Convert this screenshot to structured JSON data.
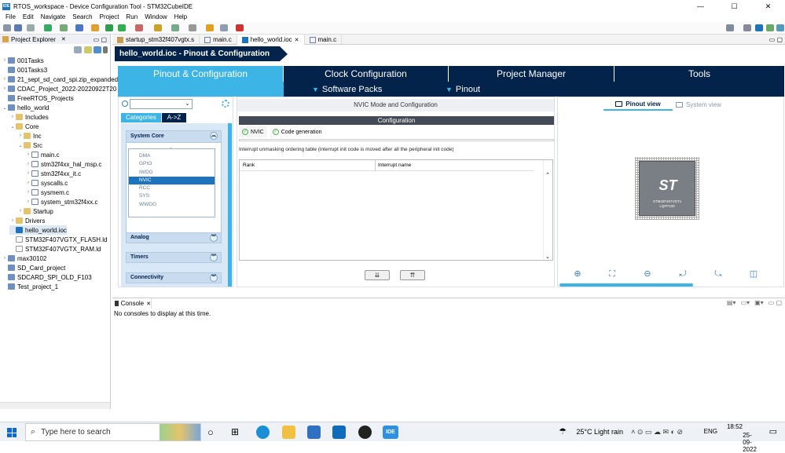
{
  "window": {
    "title": "RTOS_workspace - Device Configuration Tool - STM32CubeIDE",
    "app_icon": "IDE",
    "controls": [
      "—",
      "☐",
      "✕"
    ]
  },
  "menu": [
    "File",
    "Edit",
    "Navigate",
    "Search",
    "Project",
    "Run",
    "Window",
    "Help"
  ],
  "project_explorer": {
    "title": "Project Explorer",
    "items": [
      {
        "label": "001Tasks",
        "depth": 0,
        "arrow": "›",
        "icon": "proj"
      },
      {
        "label": "001Tasks3",
        "depth": 0,
        "arrow": "",
        "icon": "proj"
      },
      {
        "label": "21_sept_sd_card_spi.zip_expanded",
        "depth": 0,
        "arrow": "›",
        "icon": "proj"
      },
      {
        "label": "CDAC_Project_2022-20220922T20",
        "depth": 0,
        "arrow": "›",
        "icon": "proj"
      },
      {
        "label": "FreeRTOS_Projects",
        "depth": 0,
        "arrow": "",
        "icon": "proj"
      },
      {
        "label": "hello_world",
        "depth": 0,
        "arrow": "⌄",
        "icon": "proj"
      },
      {
        "label": "Includes",
        "depth": 1,
        "arrow": "›",
        "icon": "fold"
      },
      {
        "label": "Core",
        "depth": 1,
        "arrow": "⌄",
        "icon": "fold"
      },
      {
        "label": "Inc",
        "depth": 2,
        "arrow": "›",
        "icon": "fold"
      },
      {
        "label": "Src",
        "depth": 2,
        "arrow": "⌄",
        "icon": "fold"
      },
      {
        "label": "main.c",
        "depth": 3,
        "arrow": "›",
        "icon": "file"
      },
      {
        "label": "stm32f4xx_hal_msp.c",
        "depth": 3,
        "arrow": "›",
        "icon": "file"
      },
      {
        "label": "stm32f4xx_it.c",
        "depth": 3,
        "arrow": "›",
        "icon": "file"
      },
      {
        "label": "syscalls.c",
        "depth": 3,
        "arrow": "›",
        "icon": "file"
      },
      {
        "label": "sysmem.c",
        "depth": 3,
        "arrow": "›",
        "icon": "file"
      },
      {
        "label": "system_stm32f4xx.c",
        "depth": 3,
        "arrow": "›",
        "icon": "file"
      },
      {
        "label": "Startup",
        "depth": 2,
        "arrow": "›",
        "icon": "fold"
      },
      {
        "label": "Drivers",
        "depth": 1,
        "arrow": "›",
        "icon": "fold"
      },
      {
        "label": "hello_world.ioc",
        "depth": 1,
        "arrow": "",
        "icon": "ioc"
      },
      {
        "label": "STM32F407VGTX_FLASH.ld",
        "depth": 1,
        "arrow": "",
        "icon": "ld"
      },
      {
        "label": "STM32F407VGTX_RAM.ld",
        "depth": 1,
        "arrow": "",
        "icon": "ld"
      },
      {
        "label": "max30102",
        "depth": 0,
        "arrow": "›",
        "icon": "proj"
      },
      {
        "label": "SD_Card_project",
        "depth": 0,
        "arrow": "",
        "icon": "proj"
      },
      {
        "label": "SDCARD_SPI_OLD_F103",
        "depth": 0,
        "arrow": "",
        "icon": "proj"
      },
      {
        "label": "Test_project_1",
        "depth": 0,
        "arrow": "",
        "icon": "proj"
      }
    ]
  },
  "editor_tabs": [
    "startup_stm32f407vgtx.s",
    "main.c",
    "hello_world.ioc",
    "main.c"
  ],
  "editor_tabs_active": 2,
  "ioc": {
    "banner": "hello_world.ioc - Pinout & Configuration",
    "main_tabs": [
      "Pinout & Configuration",
      "Clock Configuration",
      "Project Manager",
      "Tools"
    ],
    "sub_tabs": [
      "Software Packs",
      "Pinout"
    ],
    "categories_tab": "Categories",
    "az_tab": "A->Z",
    "groups": [
      "System Core",
      "Analog",
      "Timers",
      "Connectivity"
    ],
    "system_core_items": [
      "DMA",
      "GPIO",
      "IWDG",
      "NVIC",
      "RCC",
      "SYS",
      "WWDG"
    ],
    "selected_item": "NVIC",
    "mode_title": "NVIC Mode and Configuration",
    "config_bar": "Configuration",
    "config_tabs": [
      "NVIC",
      "Code generation"
    ],
    "note": "Interrupt unmasking ordering table (interrupt init code is moved after all the peripheral init code)",
    "table_headers": [
      "Rank",
      "Interrupt name"
    ],
    "pinout_view": "Pinout view",
    "system_view": "System view",
    "chip_logo": "ST",
    "chip_name": "STM32F407VGTx",
    "chip_package": "LQFP100"
  },
  "console": {
    "tab": "Console",
    "message": "No consoles to display at this time."
  },
  "taskbar": {
    "search_placeholder": "Type here to search",
    "weather": "25°C  Light rain",
    "lang": "ENG",
    "time": "18:52",
    "date": "25-09-2022"
  },
  "colors": {
    "st_dark": "#03234b",
    "st_light": "#3cb4e6",
    "selection": "#1e73be"
  }
}
